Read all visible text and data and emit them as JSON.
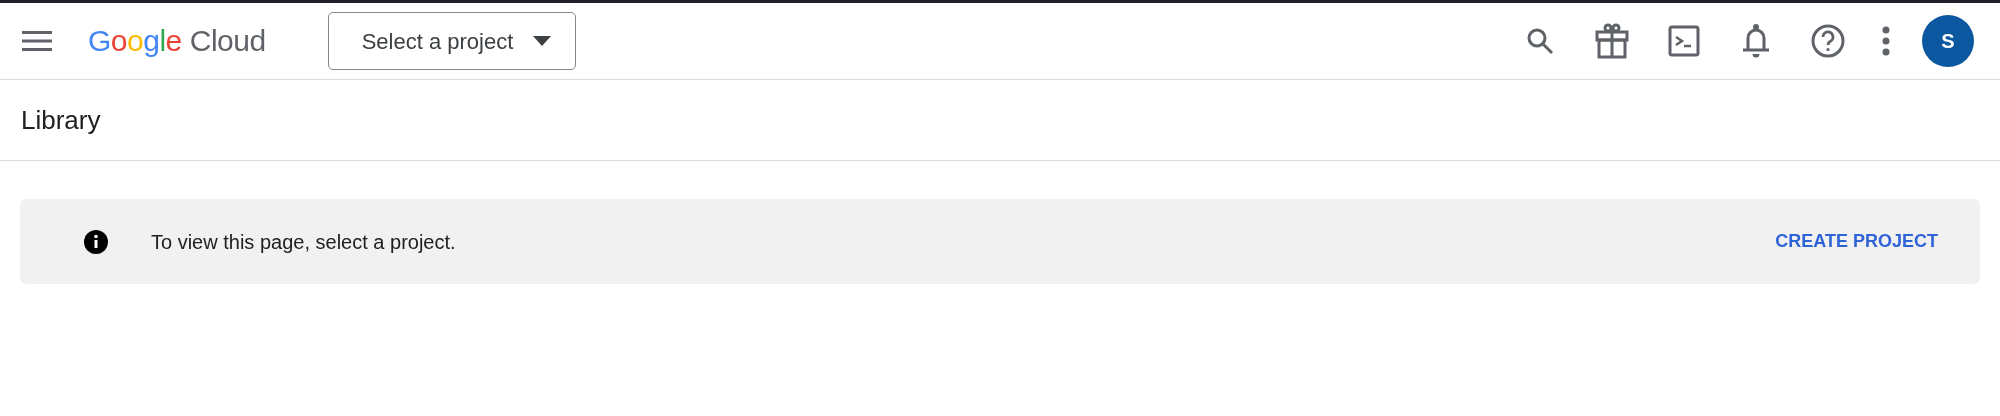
{
  "header": {
    "logo": {
      "brand": "Google",
      "product": "Cloud"
    },
    "project_picker": {
      "label": "Select a project"
    },
    "avatar": {
      "initial": "S"
    }
  },
  "page": {
    "title": "Library"
  },
  "banner": {
    "message": "To view this page, select a project.",
    "action": "CREATE PROJECT"
  }
}
